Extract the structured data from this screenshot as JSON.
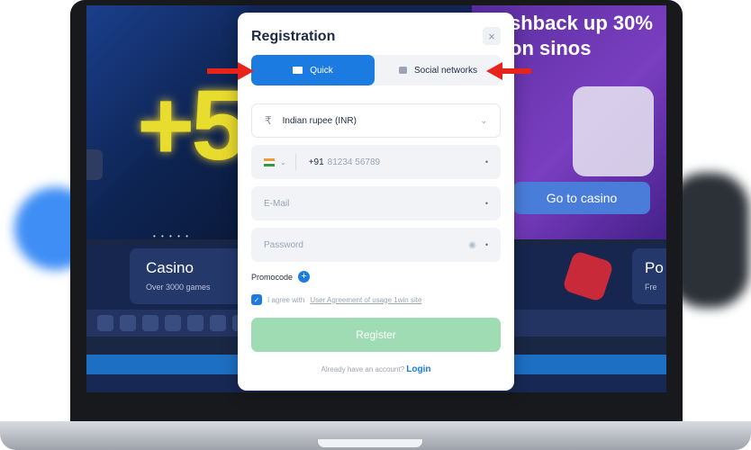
{
  "background": {
    "promo_text": "+5",
    "cashback_text": "shback up 30% on sinos",
    "goto_casino_label": "Go to casino",
    "slider_dots": "• • • • •",
    "casino_card": {
      "title": "Casino",
      "subtitle": "Over 3000 games"
    },
    "poker_card": {
      "title": "Po",
      "subtitle": "Fre"
    }
  },
  "modal": {
    "title": "Registration",
    "close_label": "×",
    "tabs": [
      {
        "label": "Quick",
        "icon": "mail-icon",
        "active": true
      },
      {
        "label": "Social networks",
        "icon": "chat-icon",
        "active": false
      }
    ],
    "currency": {
      "symbol": "₹",
      "value": "Indian rupee (INR)"
    },
    "phone": {
      "country_code": "+91",
      "placeholder": "81234 56789"
    },
    "email": {
      "placeholder": "E-Mail"
    },
    "password": {
      "placeholder": "Password"
    },
    "promocode_label": "Promocode",
    "agree_text": "I agree with",
    "agree_link": "User Agreement of usage 1win site",
    "register_label": "Register",
    "login_prompt": "Already have an account?",
    "login_link": "Login"
  },
  "colors": {
    "accent_blue": "#1b7be0",
    "register_green": "#9fdcb3",
    "arrow_red": "#e8231c"
  }
}
